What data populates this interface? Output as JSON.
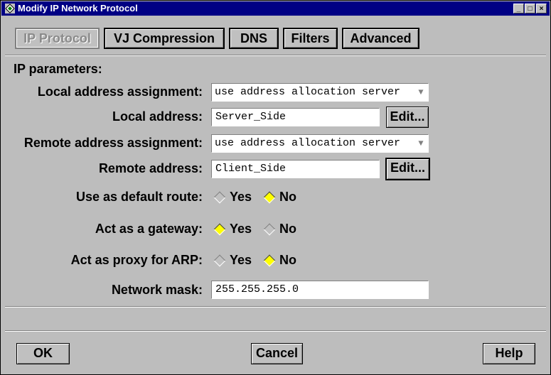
{
  "window": {
    "title": "Modify IP Network Protocol",
    "controls": [
      "_",
      "□",
      "×"
    ]
  },
  "tabs": [
    {
      "label": "IP Protocol",
      "active": true
    },
    {
      "label": "VJ Compression",
      "active": false
    },
    {
      "label": "DNS",
      "active": false
    },
    {
      "label": "Filters",
      "active": false
    },
    {
      "label": "Advanced",
      "active": false
    }
  ],
  "section_title": "IP parameters:",
  "local_assignment": {
    "label": "Local address assignment:",
    "value": "use address allocation server"
  },
  "local_address": {
    "label": "Local address:",
    "value": "Server_Side",
    "edit_label": "Edit..."
  },
  "remote_assignment": {
    "label": "Remote address assignment:",
    "value": "use address allocation server"
  },
  "remote_address": {
    "label": "Remote address:",
    "value": "Client_Side",
    "edit_label": "Edit..."
  },
  "default_route": {
    "label": "Use as default route:",
    "yes": "Yes",
    "no": "No",
    "selected": "No"
  },
  "gateway": {
    "label": "Act as a gateway:",
    "yes": "Yes",
    "no": "No",
    "selected": "Yes"
  },
  "proxy_arp": {
    "label": "Act as proxy for ARP:",
    "yes": "Yes",
    "no": "No",
    "selected": "No"
  },
  "network_mask": {
    "label": "Network mask:",
    "value": "255.255.255.0"
  },
  "footer": {
    "ok": "OK",
    "cancel": "Cancel",
    "help": "Help"
  },
  "colors": {
    "titlebar": "#000084",
    "radio_selected": "#ffff00",
    "background": "#c0c0c0"
  }
}
